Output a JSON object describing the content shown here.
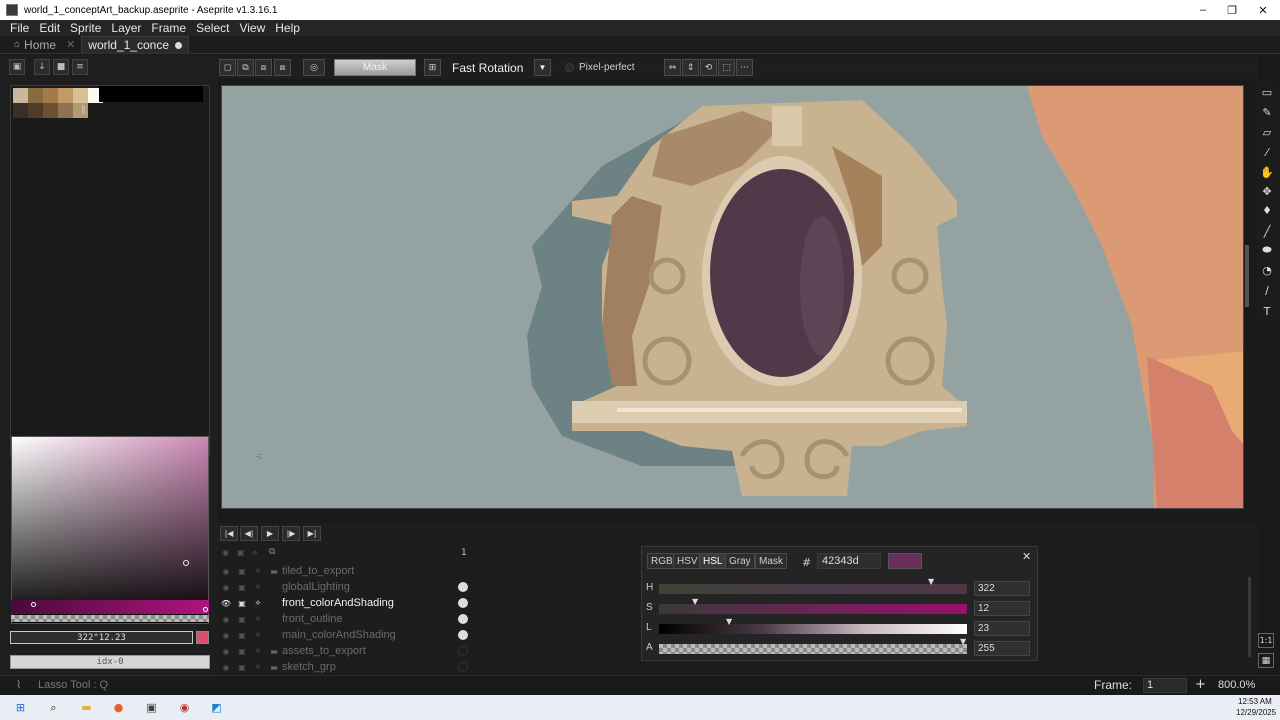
{
  "window": {
    "title": "world_1_conceptArt_backup.aseprite - Aseprite v1.3.16.1",
    "minimize": "–",
    "maximize": "❐",
    "close": "✕"
  },
  "menu": [
    "File",
    "Edit",
    "Sprite",
    "Layer",
    "Frame",
    "Select",
    "View",
    "Help"
  ],
  "tabs": [
    {
      "label": "Home",
      "close": "✕"
    },
    {
      "label": "world_1_conce"
    }
  ],
  "palette": {
    "swatches": [
      "#c9b89e",
      "#8a6a3f",
      "#a57a49",
      "#c29a66",
      "#d9bf95",
      "#fbfaef",
      "#3a2f27",
      "#4e3b2a",
      "#6b5035",
      "#8f7250",
      "#b49a73"
    ],
    "more_marker": "∥"
  },
  "color_picker": {
    "value_text": "322°12.23",
    "index_text": "idx-0"
  },
  "context_bar": {
    "mask_label": "Mask",
    "rotation_algorithm": "Fast Rotation",
    "pixel_perfect_label": "Pixel-perfect",
    "more": "···"
  },
  "timeline": {
    "frame_number": "1",
    "layers": [
      {
        "name": "tiled_to_export",
        "group": true,
        "depth": 0,
        "visible": false,
        "active": false,
        "has_cel": false
      },
      {
        "name": "globalLighting",
        "group": false,
        "depth": 1,
        "visible": false,
        "active": false,
        "has_cel": true
      },
      {
        "name": "front_colorAndShading",
        "group": false,
        "depth": 1,
        "visible": true,
        "active": true,
        "has_cel": true
      },
      {
        "name": "front_outline",
        "group": false,
        "depth": 1,
        "visible": false,
        "active": false,
        "has_cel": true
      },
      {
        "name": "main_colorAndShading",
        "group": false,
        "depth": 1,
        "visible": false,
        "active": false,
        "has_cel": true
      },
      {
        "name": "assets_to_export",
        "group": true,
        "depth": 0,
        "visible": false,
        "active": false,
        "has_cel": false
      },
      {
        "name": "sketch_grp",
        "group": true,
        "depth": 0,
        "visible": false,
        "active": false,
        "has_cel": false
      }
    ]
  },
  "color_window": {
    "modes": [
      "RGB",
      "HSV",
      "HSL",
      "Gray",
      "Mask"
    ],
    "active_mode": "HSL",
    "hash": "#",
    "hex": "42343d",
    "swatch": "#6a2f58",
    "close": "✕",
    "sliders": [
      {
        "label": "H",
        "value": "322"
      },
      {
        "label": "S",
        "value": "12"
      },
      {
        "label": "L",
        "value": "23"
      },
      {
        "label": "A",
        "value": "255"
      }
    ]
  },
  "status": {
    "tool_text": "Lasso Tool : Q",
    "frame_label": "Frame:",
    "frame_value": "1",
    "zoom": "800.0%"
  },
  "clock": {
    "time": "12:53 AM",
    "date": "12/29/2025"
  },
  "colors": {
    "canvas_bg": "#94a3a1",
    "panel": "#1e1e1e",
    "active_layer": "#f2f2f2",
    "hsl_swatch": "#6a2f58"
  }
}
